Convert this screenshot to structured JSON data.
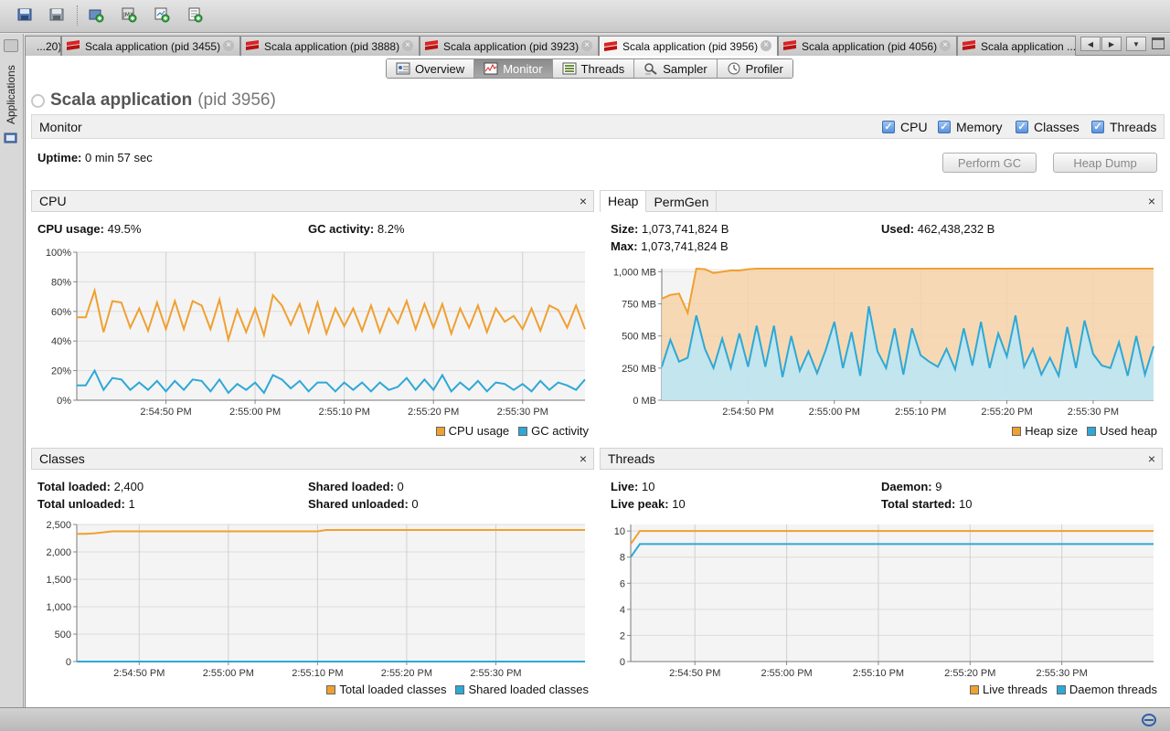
{
  "toolbar": {
    "buttons": [
      "open-icon",
      "save-icon",
      "add-jmx-icon",
      "add-host-icon",
      "add-coredump-icon",
      "add-snapshot-icon"
    ]
  },
  "sidebar": {
    "label": "Applications"
  },
  "tabs": [
    {
      "label": "...20)"
    },
    {
      "label": "Scala application (pid 3455)"
    },
    {
      "label": "Scala application (pid 3888)"
    },
    {
      "label": "Scala application (pid 3923)"
    },
    {
      "label": "Scala application (pid 3956)",
      "active": true
    },
    {
      "label": "Scala application (pid 4056)"
    },
    {
      "label": "Scala application ..."
    }
  ],
  "views": [
    {
      "label": "Overview",
      "icon": "overview-icon"
    },
    {
      "label": "Monitor",
      "icon": "monitor-icon",
      "active": true
    },
    {
      "label": "Threads",
      "icon": "threads-icon"
    },
    {
      "label": "Sampler",
      "icon": "sampler-icon"
    },
    {
      "label": "Profiler",
      "icon": "profiler-icon"
    }
  ],
  "app": {
    "name": "Scala application",
    "pid": "(pid 3956)"
  },
  "monitor": {
    "label": "Monitor",
    "checkboxes": {
      "cpu": "CPU",
      "memory": "Memory",
      "classes": "Classes",
      "threads": "Threads"
    },
    "uptime_label": "Uptime:",
    "uptime_value": "0 min 57 sec",
    "perform_gc": "Perform GC",
    "heap_dump": "Heap Dump"
  },
  "cpu_panel": {
    "title": "CPU",
    "usage_label": "CPU usage:",
    "usage_value": "49.5%",
    "gc_label": "GC activity:",
    "gc_value": "8.2%"
  },
  "heap_panel": {
    "tab_heap": "Heap",
    "tab_permgen": "PermGen",
    "size_label": "Size:",
    "size_value": "1,073,741,824 B",
    "used_label": "Used:",
    "used_value": "462,438,232 B",
    "max_label": "Max:",
    "max_value": "1,073,741,824 B"
  },
  "classes_panel": {
    "title": "Classes",
    "total_loaded_label": "Total loaded:",
    "total_loaded_value": "2,400",
    "total_unloaded_label": "Total unloaded:",
    "total_unloaded_value": "1",
    "shared_loaded_label": "Shared loaded:",
    "shared_loaded_value": "0",
    "shared_unloaded_label": "Shared unloaded:",
    "shared_unloaded_value": "0"
  },
  "threads_panel": {
    "title": "Threads",
    "live_label": "Live:",
    "live_value": "10",
    "live_peak_label": "Live peak:",
    "live_peak_value": "10",
    "daemon_label": "Daemon:",
    "daemon_value": "9",
    "total_started_label": "Total started:",
    "total_started_value": "10"
  },
  "chart_data": [
    {
      "id": "cpu",
      "type": "line",
      "t_start": 0,
      "t_end": 57,
      "x_ticks": [
        {
          "t": 10,
          "label": "2:54:50 PM"
        },
        {
          "t": 20,
          "label": "2:55:00 PM"
        },
        {
          "t": 30,
          "label": "2:55:10 PM"
        },
        {
          "t": 40,
          "label": "2:55:20 PM"
        },
        {
          "t": 50,
          "label": "2:55:30 PM"
        }
      ],
      "y_ticks": [
        {
          "v": 0,
          "label": "0%"
        },
        {
          "v": 20,
          "label": "20%"
        },
        {
          "v": 40,
          "label": "40%"
        },
        {
          "v": 60,
          "label": "60%"
        },
        {
          "v": 80,
          "label": "80%"
        },
        {
          "v": 100,
          "label": "100%"
        }
      ],
      "ylim": [
        0,
        100
      ],
      "series": [
        {
          "name": "CPU usage",
          "color": "#f0a030",
          "values": [
            56,
            56,
            74,
            46,
            67,
            66,
            49,
            62,
            47,
            66,
            48,
            67,
            48,
            67,
            64,
            48,
            68,
            41,
            61,
            46,
            62,
            44,
            71,
            64,
            51,
            65,
            46,
            66,
            45,
            62,
            50,
            62,
            47,
            64,
            46,
            62,
            52,
            67,
            48,
            65,
            49,
            65,
            45,
            62,
            49,
            64,
            46,
            62,
            53,
            57,
            48,
            62,
            47,
            64,
            61,
            49,
            64,
            48
          ]
        },
        {
          "name": "GC activity",
          "color": "#2ea8d6",
          "values": [
            10,
            10,
            20,
            7,
            15,
            14,
            7,
            12,
            7,
            13,
            6,
            13,
            7,
            14,
            13,
            6,
            14,
            5,
            11,
            7,
            12,
            5,
            17,
            14,
            8,
            13,
            6,
            12,
            12,
            6,
            12,
            7,
            12,
            6,
            12,
            7,
            9,
            15,
            7,
            14,
            7,
            17,
            6,
            12,
            7,
            13,
            6,
            12,
            11,
            7,
            11,
            6,
            13,
            7,
            12,
            10,
            7,
            14
          ]
        }
      ]
    },
    {
      "id": "heap",
      "type": "area",
      "t_start": 0,
      "t_end": 57,
      "x_ticks": [
        {
          "t": 10,
          "label": "2:54:50 PM"
        },
        {
          "t": 20,
          "label": "2:55:00 PM"
        },
        {
          "t": 30,
          "label": "2:55:10 PM"
        },
        {
          "t": 40,
          "label": "2:55:20 PM"
        },
        {
          "t": 50,
          "label": "2:55:30 PM"
        }
      ],
      "y_ticks": [
        {
          "v": 0,
          "label": "0 MB"
        },
        {
          "v": 250,
          "label": "250 MB"
        },
        {
          "v": 500,
          "label": "500 MB"
        },
        {
          "v": 750,
          "label": "750 MB"
        },
        {
          "v": 1000,
          "label": "1,000 MB"
        }
      ],
      "ylim": [
        0,
        1024
      ],
      "series": [
        {
          "name": "Heap size",
          "color": "#f0a030",
          "values": [
            790,
            820,
            830,
            680,
            1024,
            1020,
            990,
            1000,
            1010,
            1010,
            1020,
            1024,
            1024,
            1024,
            1024,
            1024,
            1024,
            1024,
            1024,
            1024,
            1024,
            1024,
            1024,
            1024,
            1024,
            1024,
            1024,
            1024,
            1024,
            1024,
            1024,
            1024,
            1024,
            1024,
            1024,
            1024,
            1024,
            1024,
            1024,
            1024,
            1024,
            1024,
            1024,
            1024,
            1024,
            1024,
            1024,
            1024,
            1024,
            1024,
            1024,
            1024,
            1024,
            1024,
            1024,
            1024,
            1024,
            1024
          ]
        },
        {
          "name": "Used heap",
          "color": "#2ea8d6",
          "values": [
            260,
            470,
            300,
            330,
            660,
            400,
            250,
            480,
            250,
            520,
            260,
            580,
            260,
            580,
            180,
            500,
            230,
            380,
            210,
            390,
            610,
            250,
            530,
            190,
            730,
            380,
            250,
            560,
            200,
            560,
            350,
            300,
            260,
            400,
            240,
            560,
            270,
            610,
            250,
            520,
            340,
            660,
            260,
            400,
            200,
            330,
            190,
            570,
            250,
            620,
            360,
            270,
            250,
            450,
            190,
            500,
            200,
            420
          ]
        }
      ]
    },
    {
      "id": "classes",
      "type": "line",
      "t_start": 0,
      "t_end": 57,
      "x_ticks": [
        {
          "t": 7,
          "label": "2:54:50 PM"
        },
        {
          "t": 17,
          "label": "2:55:00 PM"
        },
        {
          "t": 27,
          "label": "2:55:10 PM"
        },
        {
          "t": 37,
          "label": "2:55:20 PM"
        },
        {
          "t": 47,
          "label": "2:55:30 PM"
        }
      ],
      "y_ticks": [
        {
          "v": 0,
          "label": "0"
        },
        {
          "v": 500,
          "label": "500"
        },
        {
          "v": 1000,
          "label": "1,000"
        },
        {
          "v": 1500,
          "label": "1,500"
        },
        {
          "v": 2000,
          "label": "2,000"
        },
        {
          "v": 2500,
          "label": "2,500"
        }
      ],
      "ylim": [
        0,
        2500
      ],
      "series": [
        {
          "name": "Total loaded classes",
          "color": "#f0a030",
          "points": [
            [
              0,
              2330
            ],
            [
              1,
              2330
            ],
            [
              2,
              2340
            ],
            [
              4,
              2375
            ],
            [
              27,
              2375
            ],
            [
              28,
              2400
            ],
            [
              57,
              2400
            ]
          ]
        },
        {
          "name": "Shared loaded classes",
          "color": "#2ea8d6",
          "points": [
            [
              0,
              0
            ],
            [
              57,
              0
            ]
          ]
        }
      ]
    },
    {
      "id": "threads",
      "type": "line",
      "t_start": 0,
      "t_end": 57,
      "x_ticks": [
        {
          "t": 7,
          "label": "2:54:50 PM"
        },
        {
          "t": 17,
          "label": "2:55:00 PM"
        },
        {
          "t": 27,
          "label": "2:55:10 PM"
        },
        {
          "t": 37,
          "label": "2:55:20 PM"
        },
        {
          "t": 47,
          "label": "2:55:30 PM"
        }
      ],
      "y_ticks": [
        {
          "v": 0,
          "label": "0"
        },
        {
          "v": 2,
          "label": "2"
        },
        {
          "v": 4,
          "label": "4"
        },
        {
          "v": 6,
          "label": "6"
        },
        {
          "v": 8,
          "label": "8"
        },
        {
          "v": 10,
          "label": "10"
        }
      ],
      "ylim": [
        0,
        10.5
      ],
      "series": [
        {
          "name": "Live threads",
          "color": "#f0a030",
          "points": [
            [
              0,
              9
            ],
            [
              1,
              10
            ],
            [
              57,
              10
            ]
          ]
        },
        {
          "name": "Daemon threads",
          "color": "#2ea8d6",
          "points": [
            [
              0,
              8
            ],
            [
              1,
              9
            ],
            [
              57,
              9
            ]
          ]
        }
      ]
    }
  ]
}
